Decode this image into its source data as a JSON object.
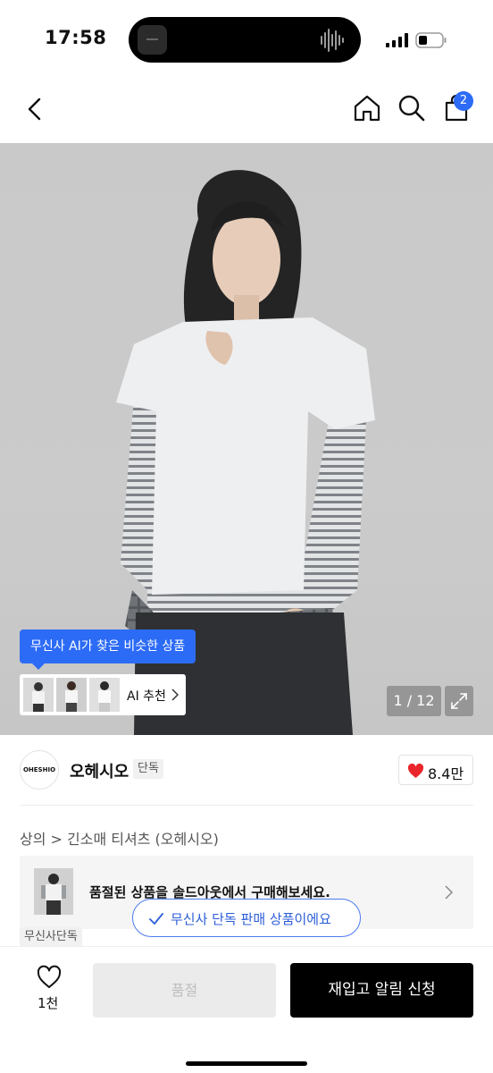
{
  "status_bar": {
    "time": "17:58"
  },
  "nav": {
    "cart_count": "2"
  },
  "hero": {
    "ai_tooltip": "무신사 AI가 찾은 비슷한 상품",
    "ai_label": "AI 추천",
    "page_counter": "1 / 12"
  },
  "brand": {
    "logo_text": "OHESHIO",
    "name": "오헤시오",
    "tag": "단독",
    "like_count": "8.4만"
  },
  "breadcrumb": "상의 > 긴소매 티셔츠 (오헤시오)",
  "soldout_banner": {
    "text": "품절된 상품을 솔드아웃에서 구매해보세요.",
    "tag": "무신사단독"
  },
  "exclusive_pill": "무신사 단독 판매 상품이에요",
  "bottom_bar": {
    "wish_count": "1천",
    "soldout_label": "품절",
    "restock_label": "재입고 알림 신청"
  },
  "colors": {
    "accent_blue": "#2c6bf6",
    "like_red": "#e8262b",
    "primary_black": "#000000"
  }
}
